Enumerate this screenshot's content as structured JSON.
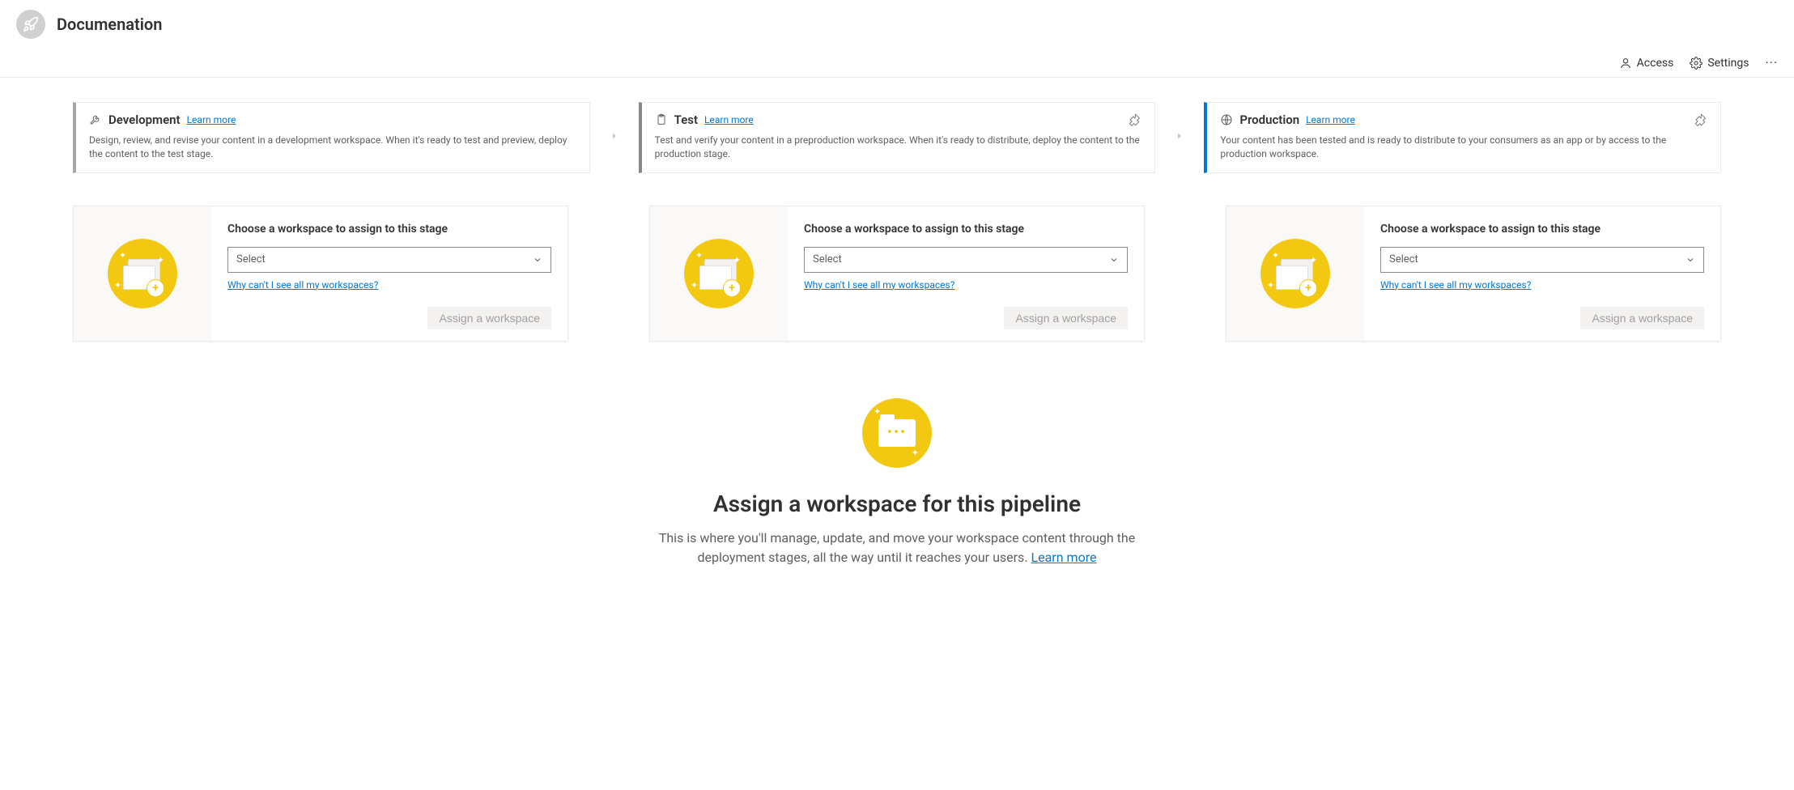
{
  "header": {
    "title": "Documenation"
  },
  "toolbar": {
    "access": "Access",
    "settings": "Settings"
  },
  "stages": {
    "dev": {
      "name": "Development",
      "learn": "Learn more",
      "desc": "Design, review, and revise your content in a development workspace. When it's ready to test and preview, deploy the content to the test stage."
    },
    "test": {
      "name": "Test",
      "learn": "Learn more",
      "desc": "Test and verify your content in a preproduction workspace. When it's ready to distribute, deploy the content to the production stage."
    },
    "prod": {
      "name": "Production",
      "learn": "Learn more",
      "desc": "Your content has been tested and is ready to distribute to your consumers as an app or by access to the production workspace."
    }
  },
  "workspace": {
    "title": "Choose a workspace to assign to this stage",
    "select_placeholder": "Select",
    "help": "Why can't I see all my workspaces?",
    "assign_btn": "Assign a workspace"
  },
  "empty": {
    "title": "Assign a workspace for this pipeline",
    "desc_a": "This is where you'll manage, update, and move your workspace content through the deployment stages, all the way until it reaches your users. ",
    "learn": "Learn more"
  }
}
